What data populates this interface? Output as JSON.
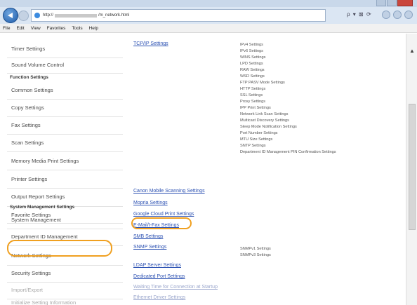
{
  "browser": {
    "address": "http://",
    "address_suffix": "/m_network.html",
    "search_refresh": "ρ ▾ ⊠ ⟳",
    "menus": [
      "File",
      "Edit",
      "View",
      "Favorites",
      "Tools",
      "Help"
    ]
  },
  "sidebar": {
    "timer_settings": "Timer Settings",
    "sound_volume": "Sound Volume Control",
    "function_settings_header": "Function Settings",
    "common_settings": "Common Settings",
    "copy_settings": "Copy Settings",
    "fax_settings": "Fax Settings",
    "scan_settings": "Scan Settings",
    "memory_media": "Memory Media Print Settings",
    "printer_settings": "Printer Settings",
    "output_report": "Output Report Settings",
    "favorite_settings": "Favorite Settings",
    "system_mgmt_header": "System Management Settings",
    "system_management": "System Management",
    "dept_id": "Department ID Management",
    "network_settings": "Network Settings",
    "security_settings": "Security Settings",
    "import_export": "Import/Export",
    "initialize": "Initialize Setting Information"
  },
  "main": {
    "tcpip": "TCP/IP Settings",
    "tcpip_subs": [
      "IPv4 Settings",
      "IPv6 Settings",
      "WINS Settings",
      "LPD Settings",
      "RAW Settings",
      "WSD Settings",
      "FTP PASV Mode Settings",
      "HTTP Settings",
      "SSL Settings",
      "Proxy Settings",
      "IPP Print Settings",
      "Network Link Scan Settings",
      "Multicast Discovery Settings",
      "Sleep Mode Notification Settings",
      "Port Number Settings",
      "MTU Size Settings",
      "SNTP Settings",
      "Department ID Management PIN Confirmation Settings"
    ],
    "canon_mobile": "Canon Mobile Scanning Settings",
    "mopria": "Mopria Settings",
    "google_cloud": "Google Cloud Print Settings",
    "email_fax": "E-Mail/I-Fax Settings",
    "smb": "SMB Settings",
    "snmp": "SNMP Settings",
    "snmp_subs": [
      "SNMPv1 Settings",
      "SNMPv3 Settings"
    ],
    "ldap": "LDAP Server Settings",
    "dedicated_port": "Dedicated Port Settings",
    "waiting_time": "Waiting Time for Connection at Startup",
    "ethernet_driver": "Ethernet Driver Settings"
  },
  "colors": {
    "highlight": "#f0a020",
    "link": "#2d52b3"
  }
}
